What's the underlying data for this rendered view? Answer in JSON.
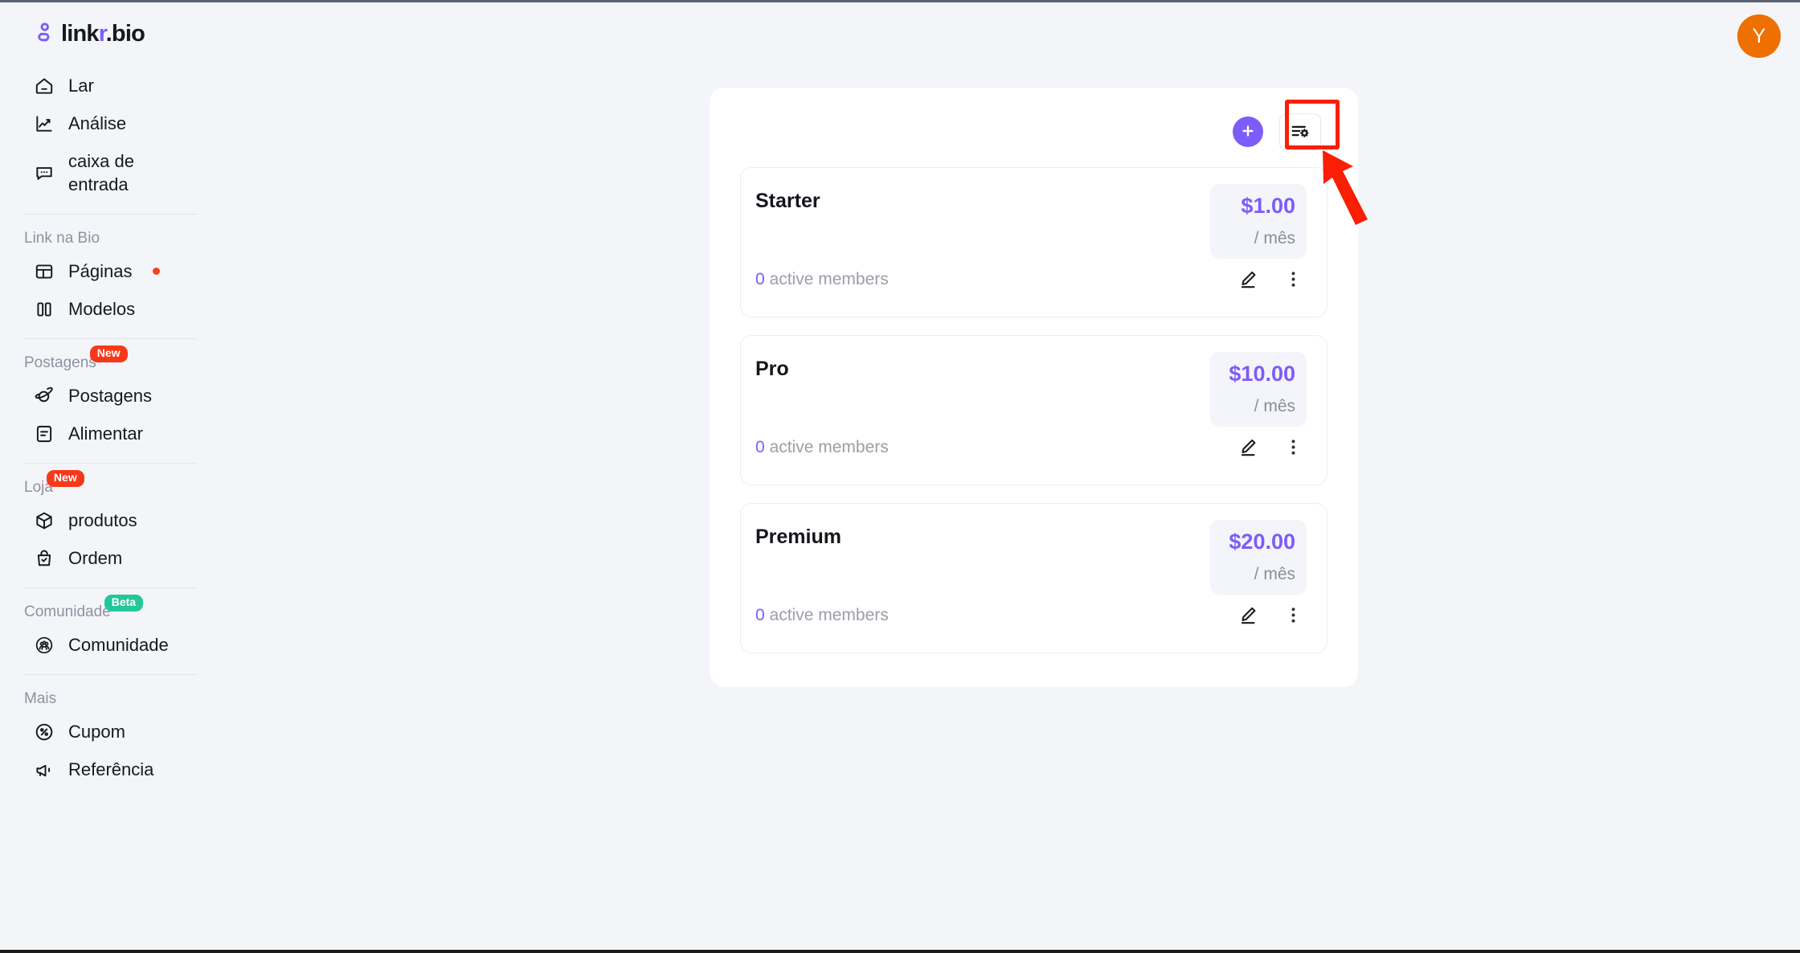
{
  "brand": {
    "name_prefix": "link",
    "name_accent": "r",
    "name_suffix": ".bio",
    "logo_icon": "person-link-icon",
    "accent_color": "#7c5cfa"
  },
  "header": {
    "avatar_initial": "Y",
    "avatar_color": "#ee7000"
  },
  "sidebar": {
    "primary": [
      {
        "label": "Lar",
        "icon": "home-icon"
      },
      {
        "label": "Análise",
        "icon": "chart-line-icon"
      },
      {
        "label": "caixa de\nentrada",
        "icon": "inbox-message-icon"
      }
    ],
    "sections": [
      {
        "title": "Link na Bio",
        "badge": null,
        "items": [
          {
            "label": "Páginas",
            "icon": "layout-panel-icon",
            "dot": true
          },
          {
            "label": "Modelos",
            "icon": "columns-icon",
            "dot": false
          }
        ]
      },
      {
        "title": "Postagens",
        "badge": {
          "text": "New",
          "color": "#f8381a"
        },
        "items": [
          {
            "label": "Postagens",
            "icon": "planet-icon",
            "dot": false
          },
          {
            "label": "Alimentar",
            "icon": "feed-document-icon",
            "dot": false
          }
        ]
      },
      {
        "title": "Loja",
        "badge": {
          "text": "New",
          "color": "#f8381a"
        },
        "items": [
          {
            "label": "produtos",
            "icon": "box-cube-icon",
            "dot": false
          },
          {
            "label": "Ordem",
            "icon": "shopping-bag-check-icon",
            "dot": false
          }
        ]
      },
      {
        "title": "Comunidade",
        "badge": {
          "text": "Beta",
          "color": "#22c79a"
        },
        "items": [
          {
            "label": "Comunidade",
            "icon": "people-group-icon",
            "dot": false
          }
        ]
      },
      {
        "title": "Mais",
        "badge": null,
        "items": [
          {
            "label": "Cupom",
            "icon": "percent-circle-icon",
            "dot": false
          },
          {
            "label": "Referência",
            "icon": "megaphone-icon",
            "dot": false
          }
        ]
      }
    ]
  },
  "panel": {
    "toolbar": {
      "add_label": "+",
      "add_icon": "plus-icon",
      "settings_icon": "list-settings-icon"
    },
    "plans": [
      {
        "name": "Starter",
        "price": "$1.00",
        "period": "/ mês",
        "members_count": "0",
        "members_label": "active members",
        "edit_icon": "pencil-icon",
        "more_icon": "more-vertical-icon"
      },
      {
        "name": "Pro",
        "price": "$10.00",
        "period": "/ mês",
        "members_count": "0",
        "members_label": "active members",
        "edit_icon": "pencil-icon",
        "more_icon": "more-vertical-icon"
      },
      {
        "name": "Premium",
        "price": "$20.00",
        "period": "/ mês",
        "members_count": "0",
        "members_label": "active members",
        "edit_icon": "pencil-icon",
        "more_icon": "more-vertical-icon"
      }
    ]
  },
  "annotation": {
    "highlight_color": "#fa1e05",
    "target": "list-settings-button",
    "arrow_icon": "pointer-arrow-icon"
  }
}
